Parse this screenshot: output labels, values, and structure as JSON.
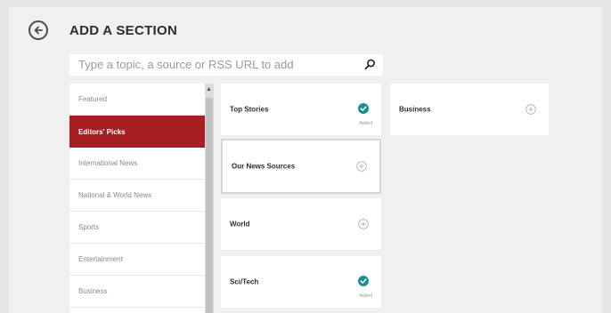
{
  "header": {
    "title": "ADD A SECTION",
    "back_icon": "back-arrow-icon"
  },
  "search": {
    "placeholder": "Type a topic, a source or RSS URL to add",
    "icon": "search-icon"
  },
  "categories": [
    {
      "label": "Featured",
      "active": false
    },
    {
      "label": "Editors' Picks",
      "active": true
    },
    {
      "label": "International News",
      "active": false
    },
    {
      "label": "National & World News",
      "active": false
    },
    {
      "label": "Sports",
      "active": false
    },
    {
      "label": "Entertainment",
      "active": false
    },
    {
      "label": "Business",
      "active": false
    }
  ],
  "sections": [
    {
      "label": "Top Stories",
      "state": "added",
      "caption": "Added"
    },
    {
      "label": "Our News Sources",
      "state": "add"
    },
    {
      "label": "World",
      "state": "add"
    },
    {
      "label": "Sci/Tech",
      "state": "added",
      "caption": "Added"
    },
    {
      "label": "Business",
      "state": "add"
    }
  ],
  "colors": {
    "accent_red": "#a81e23",
    "added_teal": "#1a8f8f",
    "background": "#f0f0f0"
  }
}
